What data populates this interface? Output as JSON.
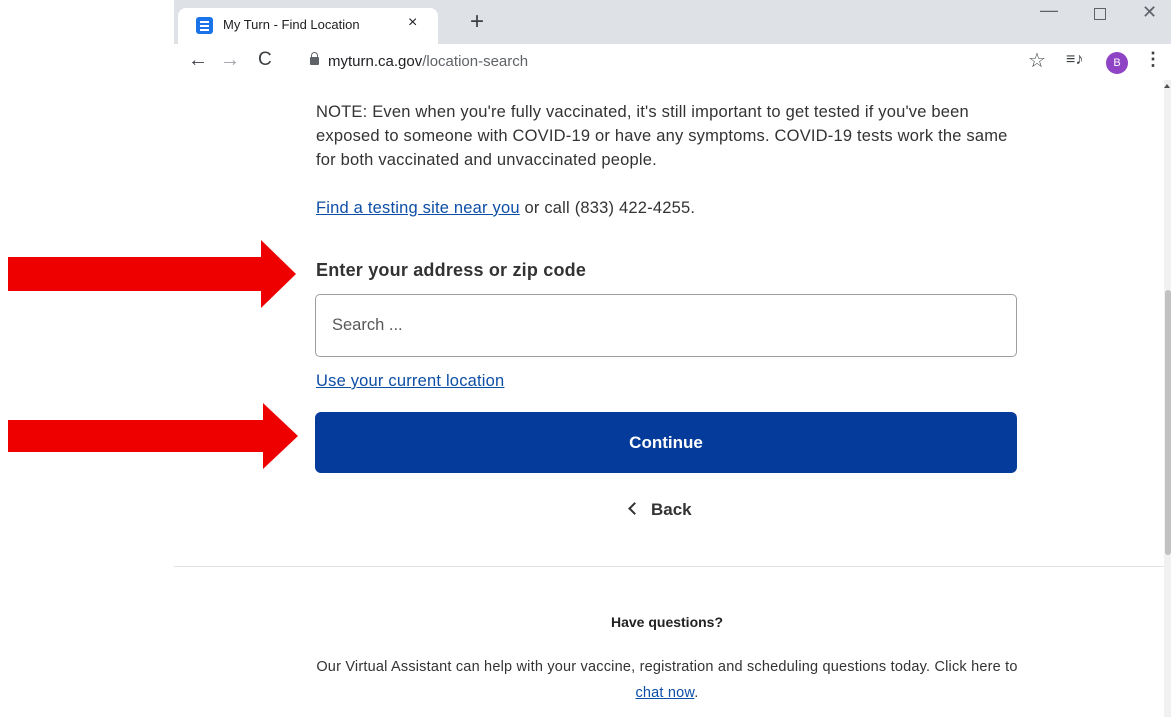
{
  "browser": {
    "tab_title": "My Turn - Find Location",
    "tab_close": "×",
    "new_tab": "+",
    "url_host": "myturn.ca.gov",
    "url_path": "/location-search",
    "avatar_letter": "B",
    "min_glyph": "—",
    "close_glyph": "✕",
    "back_glyph": "←",
    "forward_glyph": "→",
    "reload_glyph": "C",
    "star_glyph": "☆",
    "media_glyph": "≡♪",
    "menu_glyph": "⋮"
  },
  "content": {
    "note": "NOTE: Even when you're fully vaccinated, it's still important to get tested if you've been exposed to someone with COVID-19 or have any symptoms. COVID-19 tests work the same for both vaccinated and unvaccinated people.",
    "find_link": "Find a testing site near you",
    "find_suffix": " or call (833) 422-4255.",
    "address_label": "Enter your address or zip code",
    "search_placeholder": "Search ...",
    "current_location_link": "Use your current location",
    "continue_label": "Continue",
    "back_label": "Back"
  },
  "footer": {
    "questions_heading": "Have questions?",
    "assistant_text": "Our Virtual Assistant can help with your vaccine, registration and scheduling questions today. Click here to ",
    "chat_link": "chat now",
    "chat_suffix": "."
  },
  "colors": {
    "primary_button": "#053b9a",
    "link": "#0d4ea6",
    "annotation_arrow": "#ee0000",
    "avatar": "#8e44c4"
  }
}
